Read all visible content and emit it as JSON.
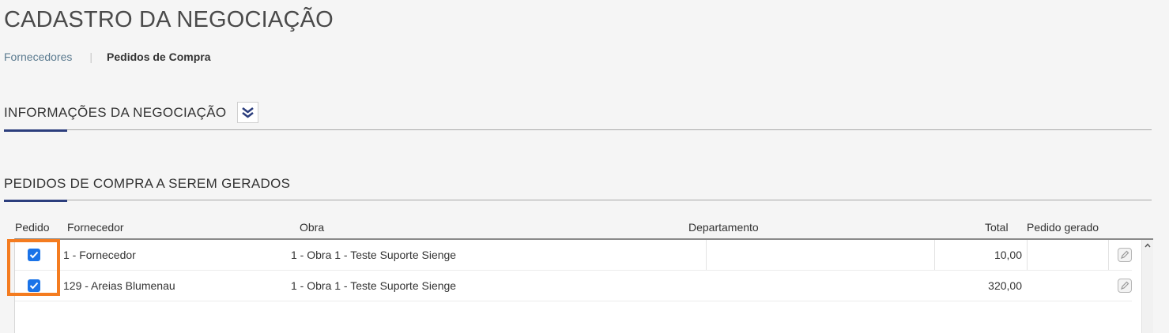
{
  "page": {
    "title": "CADASTRO DA NEGOCIAÇÃO"
  },
  "tabs": {
    "items": [
      "Fornecedores",
      "Pedidos de Compra"
    ],
    "separator": "|"
  },
  "sections": {
    "info": {
      "title": "INFORMAÇÕES DA NEGOCIAÇÃO",
      "expand_icon": "double-chevron-down-icon"
    },
    "orders": {
      "title": "PEDIDOS DE COMPRA A SEREM GERADOS"
    }
  },
  "grid": {
    "columns": [
      "Pedido",
      "Fornecedor",
      "Obra",
      "Departamento",
      "Total",
      "Pedido gerado"
    ],
    "rows": [
      {
        "checked": true,
        "fornecedor": "1 - Fornecedor",
        "obra": "1 - Obra 1 - Teste Suporte Sienge",
        "departamento": "",
        "total": "10,00",
        "pedido_gerado": ""
      },
      {
        "checked": true,
        "fornecedor": "129 - Areias Blumenau",
        "obra": "1 - Obra 1 - Teste Suporte Sienge",
        "departamento": "",
        "total": "320,00",
        "pedido_gerado": ""
      }
    ]
  },
  "colors": {
    "accent": "#2c3e7d",
    "checkbox": "#1a73e8",
    "highlight": "#f47c20",
    "link": "#5a7a8f"
  }
}
